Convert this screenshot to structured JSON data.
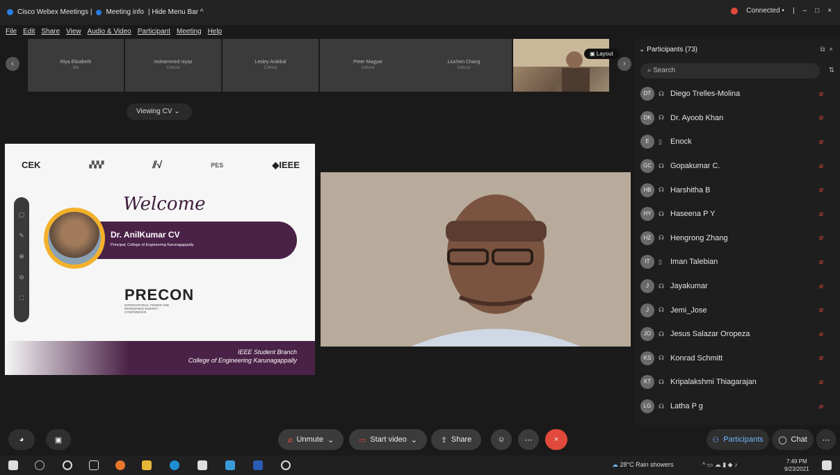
{
  "window": {
    "app_title": "Cisco Webex Meetings |",
    "meeting_info": "Meeting info",
    "hide_menu": "| Hide Menu Bar ^",
    "status": "Connected •",
    "controls": [
      "|",
      "–",
      "□",
      "×"
    ]
  },
  "menu": [
    "File",
    "Edit",
    "Share",
    "View",
    "Audio & Video",
    "Participant",
    "Meeting",
    "Help"
  ],
  "thumbnails": [
    {
      "name": "Riya Elizabeth",
      "sub": "Me"
    },
    {
      "name": "mohammed niyaz",
      "sub": "Cohost"
    },
    {
      "name": "Lesley Arakkal",
      "sub": "Cohost"
    },
    {
      "name": "Peter Magyar",
      "sub": "Cohost"
    },
    {
      "name": "Liuchen Chang",
      "sub": "Cohost"
    }
  ],
  "layout_label": "Layout",
  "viewing_label": "Viewing CV",
  "slide": {
    "logo_left": "CEK",
    "logo_ieee": "◆IEEE",
    "logo_pes": "PES",
    "welcome": "Welcome",
    "name": "Dr. AnilKumar CV",
    "role": "Principal, College of Engineering Karunagappally",
    "precon": "PRECON",
    "precon_sub": "INTERNATIONAL POWER AND RENEWABLE ENERGY CONFERENCE",
    "branch1": "IEEE Student Branch",
    "branch2": "College of Engineering Karunagappally"
  },
  "panel": {
    "title": "Participants (73)",
    "search_placeholder": "Search",
    "participants": [
      {
        "initials": "DT",
        "name": "Diego Trelles-Molina",
        "icon": "audio"
      },
      {
        "initials": "DK",
        "name": "Dr. Ayoob Khan",
        "icon": "audio"
      },
      {
        "initials": "E",
        "name": "Enock",
        "icon": "phone"
      },
      {
        "initials": "GC",
        "name": "Gopakumar C.",
        "icon": "audio"
      },
      {
        "initials": "HB",
        "name": "Harshitha B",
        "icon": "audio"
      },
      {
        "initials": "HY",
        "name": "Haseena P Y",
        "icon": "audio"
      },
      {
        "initials": "HZ",
        "name": "Hengrong Zhang",
        "icon": "audio"
      },
      {
        "initials": "IT",
        "name": "Iman Talebian",
        "icon": "phone"
      },
      {
        "initials": "J",
        "name": "Jayakumar",
        "icon": "audio"
      },
      {
        "initials": "J",
        "name": "Jemi_Jose",
        "icon": "audio"
      },
      {
        "initials": "JO",
        "name": "Jesus Salazar Oropeza",
        "icon": "audio"
      },
      {
        "initials": "KS",
        "name": "Konrad Schmitt",
        "icon": "audio"
      },
      {
        "initials": "KT",
        "name": "Kripalakshmi Thiagarajan",
        "icon": "audio"
      },
      {
        "initials": "LG",
        "name": "Latha P g",
        "icon": "audio"
      }
    ]
  },
  "controls": {
    "unmute": "Unmute",
    "start_video": "Start video",
    "share": "Share",
    "participants": "Participants",
    "chat": "Chat"
  },
  "taskbar": {
    "weather": "28°C Rain showers",
    "time": "7:49 PM",
    "date": "9/23/2021"
  }
}
